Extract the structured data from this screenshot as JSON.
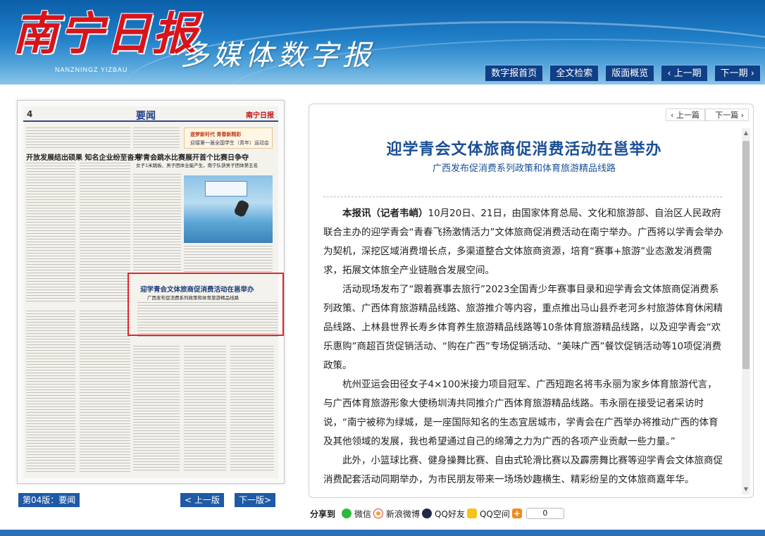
{
  "header": {
    "logo_main": "南宁日报",
    "logo_pinyin": "NANZNINGZ YIZBAU",
    "logo_sub": "多媒体数字报",
    "nav": [
      "数字报首页",
      "全文检索",
      "版面概览",
      "‹ 上一期",
      "下一期 ›"
    ]
  },
  "paper_page": {
    "page_no": "4",
    "section": "要闻",
    "brand": "南宁日报",
    "headline_left": "开放发展结出硕果  知名企业纷至沓来",
    "headline_right": "学青会跳水比赛展开首个比赛日争夺",
    "subhead_right": "女子1米跳板、男子团体全能产生，南宁队获男子团体第五名",
    "banner_line1": "逐梦新时代  青春新精彩",
    "banner_line2": "迎接第一届全国学生（青年）运动会",
    "boxed_headline": "迎学青会文体旅商促消费活动在邕举办",
    "boxed_sub": "广西发布促消费系列政策和体育旅游精品线路"
  },
  "left_footer": {
    "page_badge": "第04版：要闻",
    "prev_page": "< 上一版",
    "next_page": "下一版>"
  },
  "article": {
    "prev": "‹ 上一篇",
    "next": "下一篇 ›",
    "title": "迎学青会文体旅商促消费活动在邕举办",
    "subtitle": "广西发布促消费系列政策和体育旅游精品线路",
    "lead": "本报讯（记者韦峭）",
    "para1": "10月20日、21日，由国家体育总局、文化和旅游部、自治区人民政府联合主办的迎学青会“青春飞扬激情活力”文体旅商促消费活动在南宁举办。广西将以学青会举办为契机，深挖区域消费增长点，多渠道整合文体旅商资源，培育“赛事+旅游”业态激发消费需求，拓展文体旅全产业链融合发展空间。",
    "para2": "活动现场发布了“跟着赛事去旅行”2023全国青少年赛事目录和迎学青会文体旅商促消费系列政策、广西体育旅游精品线路、旅游推介等内容，重点推出马山县乔老河乡村旅游体育休闲精品线路、上林县世界长寿乡体育养生旅游精品线路等10条体育旅游精品线路，以及迎学青会“欢乐惠购”商超百货促销活动、“购在广西”专场促销活动、“美味广西”餐饮促销活动等10项促消费政策。",
    "para3": "杭州亚运会田径女子4×100米接力项目冠军、广西短跑名将韦永丽为家乡体育旅游代言，与广西体育旅游形象大使杨圳涛共同推介广西体育旅游精品线路。韦永丽在接受记者采访时说，“南宁被称为绿城，是一座国际知名的生态宜居城市，学青会在广西举办将推动广西的体育及其他领域的发展，我也希望通过自己的绵薄之力为广西的各项产业贡献一些力量。”",
    "para4": "此外，小篮球比赛、健身操舞比赛、自由式轮滑比赛以及霹雳舞比赛等迎学青会文体旅商促消费配套活动同期举办，为市民朋友带来一场场妙趣横生、精彩纷呈的文体旅商嘉年华。"
  },
  "share": {
    "label": "分享到",
    "items": [
      "微信",
      "新浪微博",
      "QQ好友",
      "QQ空间"
    ],
    "count": "0"
  },
  "colors": {
    "header_blue": "#1f7ec7",
    "nav_button": "#0f3f86",
    "title_blue": "#1a4f96",
    "logo_red": "#d8141b",
    "highlight_red": "#e1262d"
  }
}
